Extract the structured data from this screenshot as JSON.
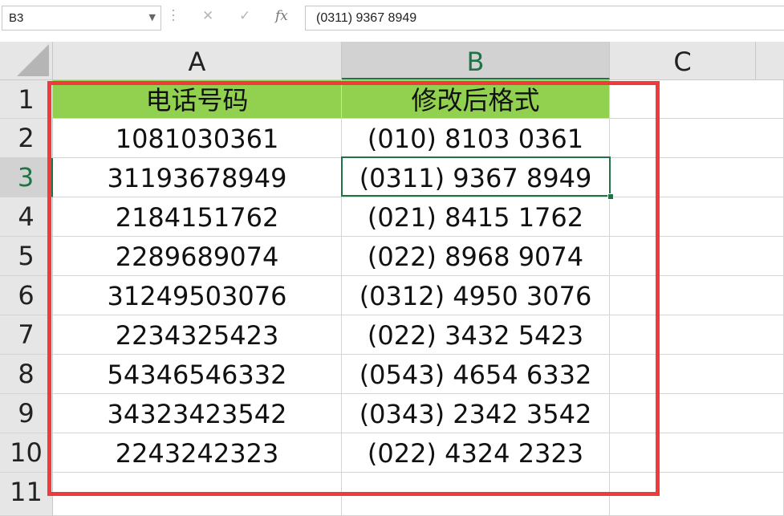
{
  "name_box": {
    "value": "B3"
  },
  "formula_bar": {
    "cancel_icon": "✕",
    "enter_icon": "✓",
    "function_icon": "fx",
    "value": "(0311) 9367 8949"
  },
  "columns": [
    "A",
    "B",
    "C"
  ],
  "rows": [
    "1",
    "2",
    "3",
    "4",
    "5",
    "6",
    "7",
    "8",
    "9",
    "10",
    "11"
  ],
  "active_cell": {
    "column": "B",
    "row": "3"
  },
  "header": {
    "a": "电话号码",
    "b": "修改后格式"
  },
  "data_rows": [
    {
      "a": "1081030361",
      "b": "(010) 8103 0361"
    },
    {
      "a": "31193678949",
      "b": "(0311) 9367 8949"
    },
    {
      "a": "2184151762",
      "b": "(021) 8415 1762"
    },
    {
      "a": "2289689074",
      "b": "(022) 8968 9074"
    },
    {
      "a": "31249503076",
      "b": "(0312) 4950 3076"
    },
    {
      "a": "2234325423",
      "b": "(022) 3432 5423"
    },
    {
      "a": "54346546332",
      "b": "(0543) 4654 6332"
    },
    {
      "a": "34323423542",
      "b": "(0343) 2342 3542"
    },
    {
      "a": "2243242323",
      "b": "(022) 4324 2323"
    }
  ],
  "colors": {
    "header_fill": "#92d050",
    "selection": "#217346",
    "highlight_frame": "#ef3b3b"
  }
}
